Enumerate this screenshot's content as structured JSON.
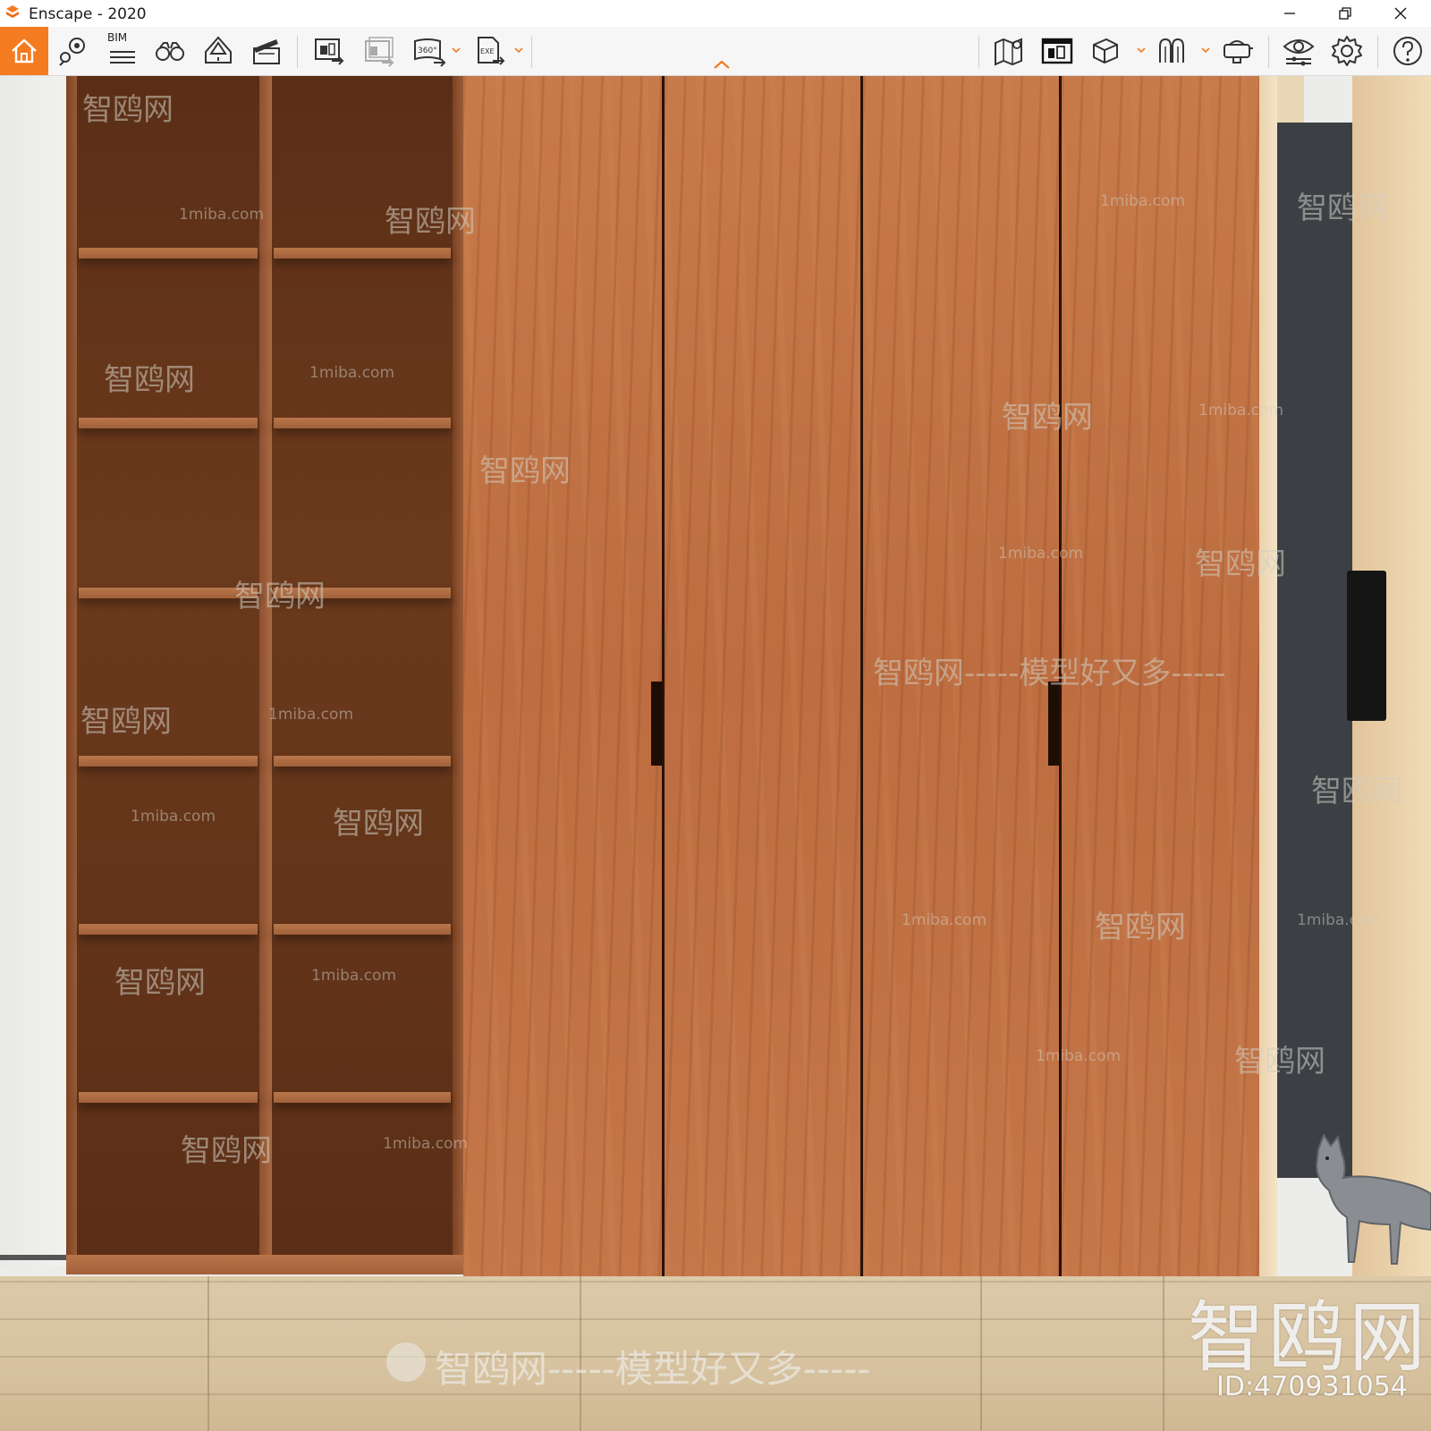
{
  "window": {
    "title": "Enscape - 2020",
    "accent_color": "#f47b20",
    "controls": [
      "minimize-icon",
      "restore-icon",
      "close-icon"
    ]
  },
  "toolbar": {
    "home_icon": "home-icon",
    "bim_label": "BIM",
    "left_tools": [
      "views-pin-icon",
      "bim-list-icon",
      "binoculars-icon",
      "cone-light-icon",
      "clapperboard-icon",
      "screenshot-export-icon",
      "batch-export-icon",
      "panorama-360-icon",
      "exe-export-icon"
    ],
    "panorama_label": "360°",
    "exe_label": "EXE",
    "right_tools": [
      "map-icon",
      "asset-library-icon",
      "cube-icon",
      "collaboration-icon",
      "vr-headset-icon",
      "visual-settings-icon",
      "settings-gear-icon",
      "help-icon"
    ]
  },
  "watermarks": {
    "site_cn": "智鸥网",
    "site_en": "1miba.com",
    "slogan": "智鸥网-----模型好又多-----",
    "slogan_short": "智鸥网-----模型好又多-----",
    "big_logo": "智鸥网",
    "id_text": "ID:470931054"
  },
  "scene": {
    "wood_color": "#c27444",
    "shelf_dark_color": "#5a2e16",
    "floor_color": "#d9c5a2"
  }
}
